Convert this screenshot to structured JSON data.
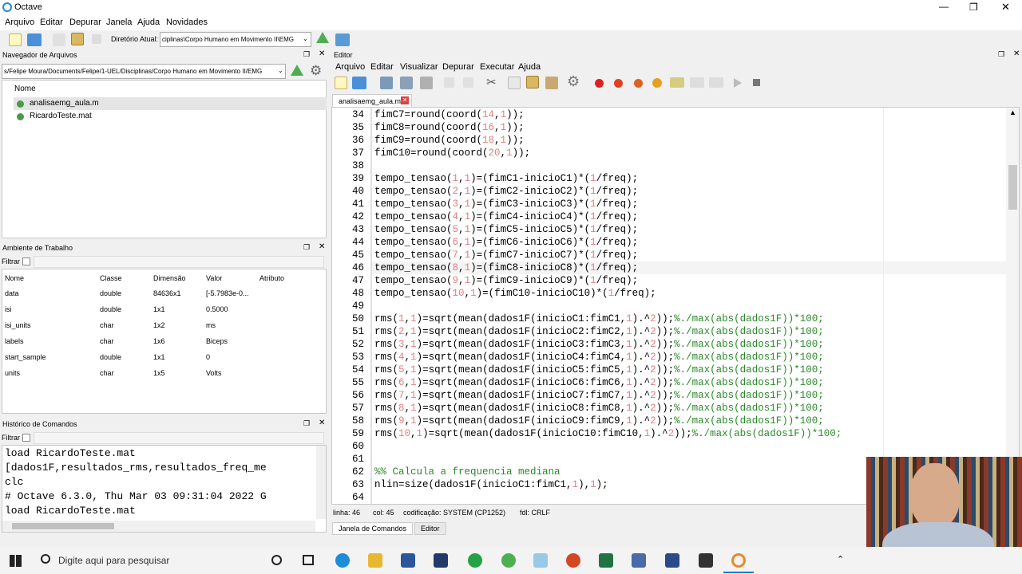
{
  "app": {
    "title": "Octave"
  },
  "menubar": [
    "Arquivo",
    "Editar",
    "Depurar",
    "Janela",
    "Ajuda",
    "Novidades"
  ],
  "toolbar": {
    "dir_label": "Diretório Atual:",
    "dir_value": "ciplinas\\Corpo Humano em Movimento II\\EMG"
  },
  "filebrowser": {
    "title": "Navegador de Arquivos",
    "path": "s/Felipe Moura/Documents/Felipe/1-UEL/Disciplinas/Corpo Humano em Movimento II/EMG",
    "col": "Nome",
    "files": [
      "analisaemg_aula.m",
      "RicardoTeste.mat"
    ]
  },
  "workspace": {
    "title": "Ambiente de Trabalho",
    "filter": "Filtrar",
    "cols": [
      "Nome",
      "Classe",
      "Dimensão",
      "Valor",
      "Atributo"
    ],
    "rows": [
      [
        "data",
        "double",
        "84636x1",
        "[-5.7983e-0...",
        ""
      ],
      [
        "isi",
        "double",
        "1x1",
        "0.5000",
        ""
      ],
      [
        "isi_units",
        "char",
        "1x2",
        "ms",
        ""
      ],
      [
        "labels",
        "char",
        "1x6",
        "Biceps",
        ""
      ],
      [
        "start_sample",
        "double",
        "1x1",
        "0",
        ""
      ],
      [
        "units",
        "char",
        "1x5",
        "Volts",
        ""
      ]
    ]
  },
  "history": {
    "title": "Histórico de Comandos",
    "filter": "Filtrar",
    "lines": [
      "load RicardoTeste.mat",
      "[dados1F,resultados_rms,resultados_freq_me",
      "clc",
      "# Octave 6.3.0, Thu Mar 03 09:31:04 2022 G",
      "load RicardoTeste.mat"
    ]
  },
  "editor": {
    "title": "Editor",
    "menu": [
      "Arquivo",
      "Editar",
      "Visualizar",
      "Depurar",
      "Executar",
      "Ajuda"
    ],
    "tab": "analisaemg_aula.m",
    "status": {
      "line": "linha: 46",
      "col": "col: 45",
      "enc": "codificação: SYSTEM (CP1252)",
      "eol": "fdl: CRLF"
    },
    "bottom_tabs": [
      "Janela de Comandos",
      "Editor"
    ],
    "lines": [
      {
        "n": "34",
        "t": "fimC7=round(coord(14,1));"
      },
      {
        "n": "35",
        "t": "fimC8=round(coord(16,1));"
      },
      {
        "n": "36",
        "t": "fimC9=round(coord(18,1));"
      },
      {
        "n": "37",
        "t": "fimC10=round(coord(20,1));"
      },
      {
        "n": "38",
        "t": ""
      },
      {
        "n": "39",
        "t": "tempo_tensao(1,1)=(fimC1-inicioC1)*(1/freq);"
      },
      {
        "n": "40",
        "t": "tempo_tensao(2,1)=(fimC2-inicioC2)*(1/freq);"
      },
      {
        "n": "41",
        "t": "tempo_tensao(3,1)=(fimC3-inicioC3)*(1/freq);"
      },
      {
        "n": "42",
        "t": "tempo_tensao(4,1)=(fimC4-inicioC4)*(1/freq);"
      },
      {
        "n": "43",
        "t": "tempo_tensao(5,1)=(fimC5-inicioC5)*(1/freq);"
      },
      {
        "n": "44",
        "t": "tempo_tensao(6,1)=(fimC6-inicioC6)*(1/freq);"
      },
      {
        "n": "45",
        "t": "tempo_tensao(7,1)=(fimC7-inicioC7)*(1/freq);"
      },
      {
        "n": "46",
        "t": "tempo_tensao(8,1)=(fimC8-inicioC8)*(1/freq);"
      },
      {
        "n": "47",
        "t": "tempo_tensao(9,1)=(fimC9-inicioC9)*(1/freq);"
      },
      {
        "n": "48",
        "t": "tempo_tensao(10,1)=(fimC10-inicioC10)*(1/freq);"
      },
      {
        "n": "49",
        "t": ""
      },
      {
        "n": "50",
        "t": "rms(1,1)=sqrt(mean(dados1F(inicioC1:fimC1,1).^2));%./max(abs(dados1F))*100;"
      },
      {
        "n": "51",
        "t": "rms(2,1)=sqrt(mean(dados1F(inicioC2:fimC2,1).^2));%./max(abs(dados1F))*100;"
      },
      {
        "n": "52",
        "t": "rms(3,1)=sqrt(mean(dados1F(inicioC3:fimC3,1).^2));%./max(abs(dados1F))*100;"
      },
      {
        "n": "53",
        "t": "rms(4,1)=sqrt(mean(dados1F(inicioC4:fimC4,1).^2));%./max(abs(dados1F))*100;"
      },
      {
        "n": "54",
        "t": "rms(5,1)=sqrt(mean(dados1F(inicioC5:fimC5,1).^2));%./max(abs(dados1F))*100;"
      },
      {
        "n": "55",
        "t": "rms(6,1)=sqrt(mean(dados1F(inicioC6:fimC6,1).^2));%./max(abs(dados1F))*100;"
      },
      {
        "n": "56",
        "t": "rms(7,1)=sqrt(mean(dados1F(inicioC7:fimC7,1).^2));%./max(abs(dados1F))*100;"
      },
      {
        "n": "57",
        "t": "rms(8,1)=sqrt(mean(dados1F(inicioC8:fimC8,1).^2));%./max(abs(dados1F))*100;"
      },
      {
        "n": "58",
        "t": "rms(9,1)=sqrt(mean(dados1F(inicioC9:fimC9,1).^2));%./max(abs(dados1F))*100;"
      },
      {
        "n": "59",
        "t": "rms(10,1)=sqrt(mean(dados1F(inicioC10:fimC10,1).^2));%./max(abs(dados1F))*100;"
      },
      {
        "n": "60",
        "t": ""
      },
      {
        "n": "61",
        "t": ""
      },
      {
        "n": "62",
        "t": "%% Calcula a frequencia mediana"
      },
      {
        "n": "63",
        "t": "nlin=size(dados1F(inicioC1:fimC1,1),1);"
      },
      {
        "n": "64",
        "t": ""
      }
    ]
  },
  "taskbar": {
    "search": "Digite aqui para pesquisar"
  },
  "colors": {
    "accent": "#1e78d2",
    "comment": "#2a8a2a",
    "number": "#e08080"
  }
}
